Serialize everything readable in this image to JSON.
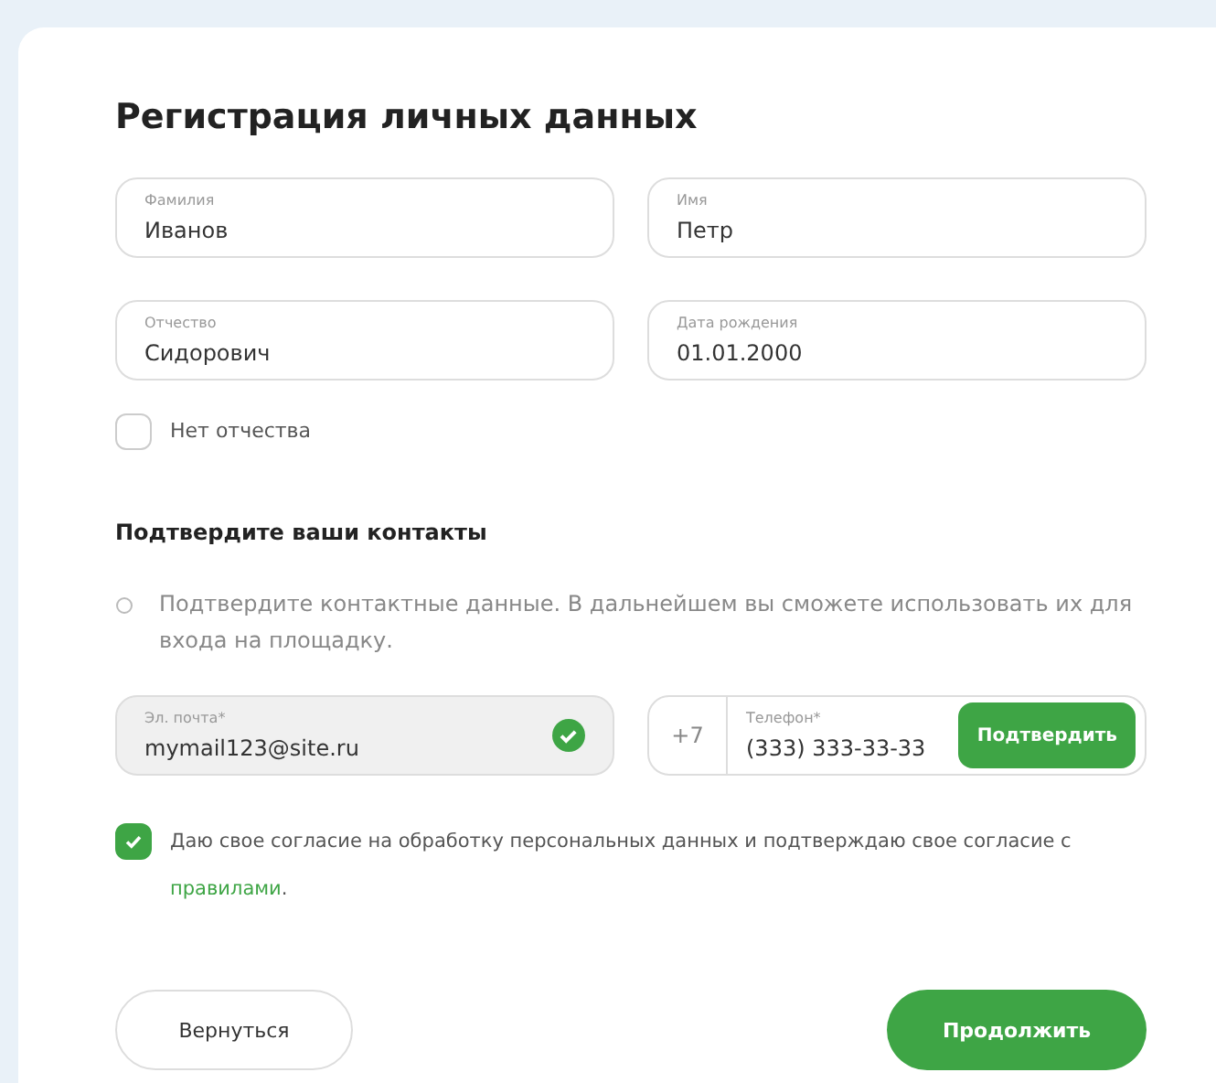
{
  "title": "Регистрация личных данных",
  "fields": [
    {
      "label": "Фамилия",
      "value": "Иванов"
    },
    {
      "label": "Имя",
      "value": "Петр"
    },
    {
      "label": "Отчество",
      "value": "Сидорович"
    },
    {
      "label": "Дата рождения",
      "value": "01.01.2000"
    }
  ],
  "no_patronymic": {
    "label": "Нет отчества",
    "checked": false
  },
  "contacts": {
    "heading": "Подтвердите ваши контакты",
    "info": "Подтвердите контактные данные. В дальнейшем вы сможете использовать их для входа на площадку.",
    "email": {
      "label": "Эл. почта*",
      "value": "mymail123@site.ru",
      "verified": true
    },
    "phone": {
      "prefix": "+7",
      "label": "Телефон*",
      "value": "(333) 333-33-33",
      "button": "Подтвердить"
    }
  },
  "consent": {
    "checked": true,
    "text": "Даю свое согласие на обработку персональных данных и подтверждаю свое согласие с",
    "link": "правилами",
    "tail": "."
  },
  "buttons": {
    "back": "Вернуться",
    "next": "Продолжить"
  }
}
